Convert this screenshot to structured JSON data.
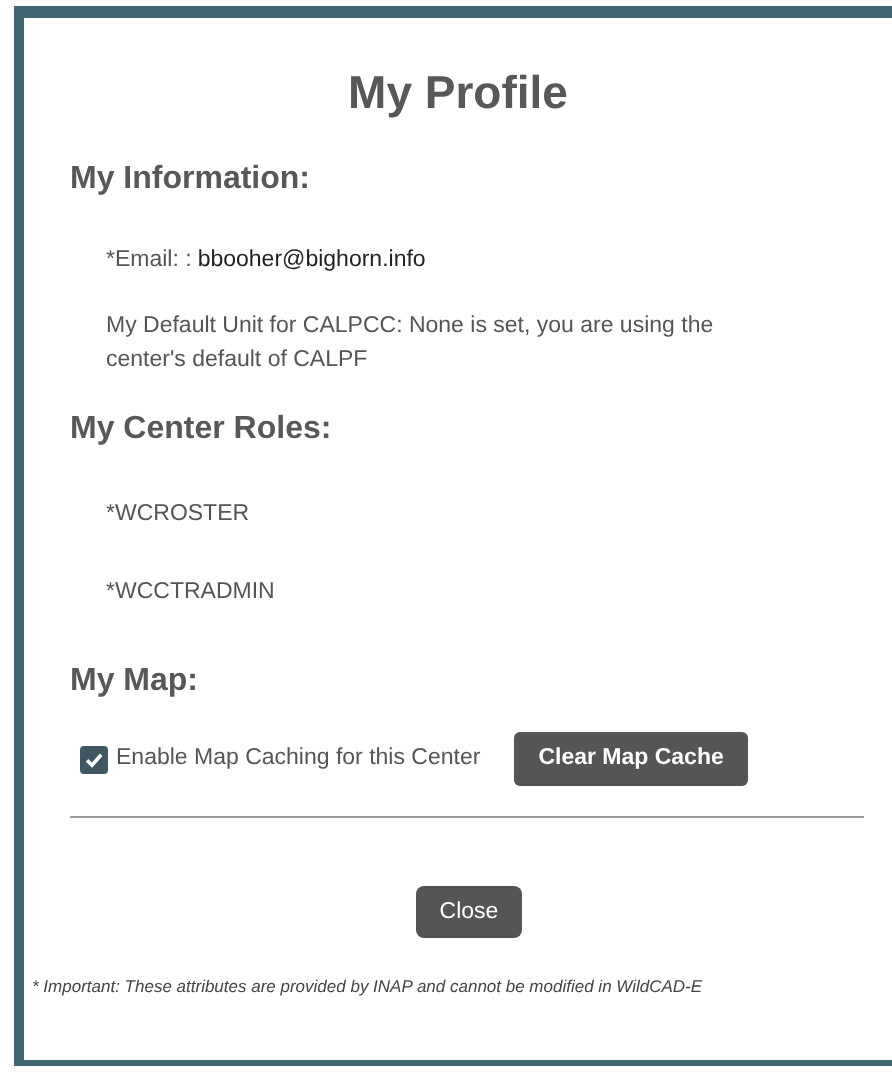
{
  "title": "My Profile",
  "information": {
    "heading": "My Information:",
    "email_label": "*Email: :",
    "email_value": "bbooher@bighorn.info",
    "default_unit": "My Default Unit for CALPCC: None is set, you are using the center's default of CALPF"
  },
  "roles": {
    "heading": "My Center Roles:",
    "items": [
      "*WCROSTER",
      "*WCCTRADMIN"
    ]
  },
  "map": {
    "heading": "My Map:",
    "caching": {
      "label": "Enable Map Caching for this Center",
      "checked": true
    },
    "clear_button": "Clear Map Cache"
  },
  "close_button": "Close",
  "footnote": "* Important: These attributes are provided by INAP and cannot be modified in WildCAD-E"
}
